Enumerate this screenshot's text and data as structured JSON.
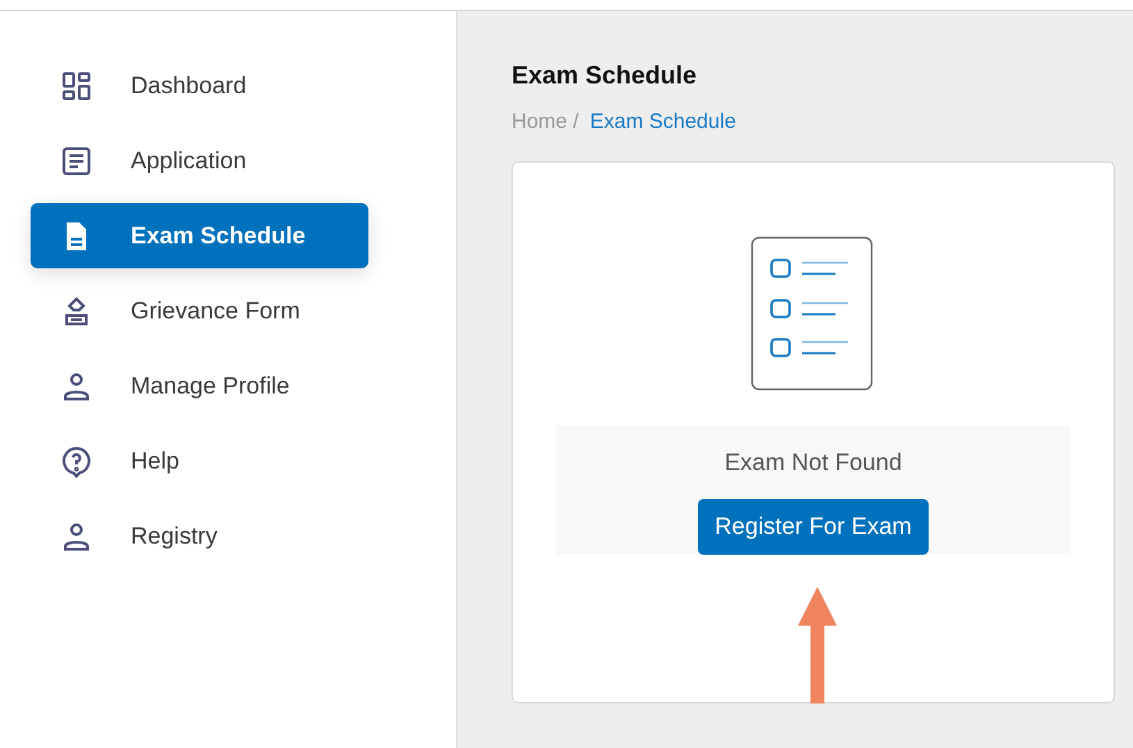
{
  "sidebar": {
    "items": [
      {
        "label": "Dashboard",
        "selected": false
      },
      {
        "label": "Application",
        "selected": false
      },
      {
        "label": "Exam Schedule",
        "selected": true
      },
      {
        "label": "Grievance Form",
        "selected": false
      },
      {
        "label": "Manage Profile",
        "selected": false
      },
      {
        "label": "Help",
        "selected": false
      },
      {
        "label": "Registry",
        "selected": false
      }
    ]
  },
  "page": {
    "title": "Exam Schedule",
    "breadcrumb": [
      {
        "label": "Home /",
        "current": false
      },
      {
        "label": "Exam Schedule",
        "current": true
      }
    ]
  },
  "empty_state": {
    "message": "Exam Not Found",
    "button": "Register For Exam"
  }
}
